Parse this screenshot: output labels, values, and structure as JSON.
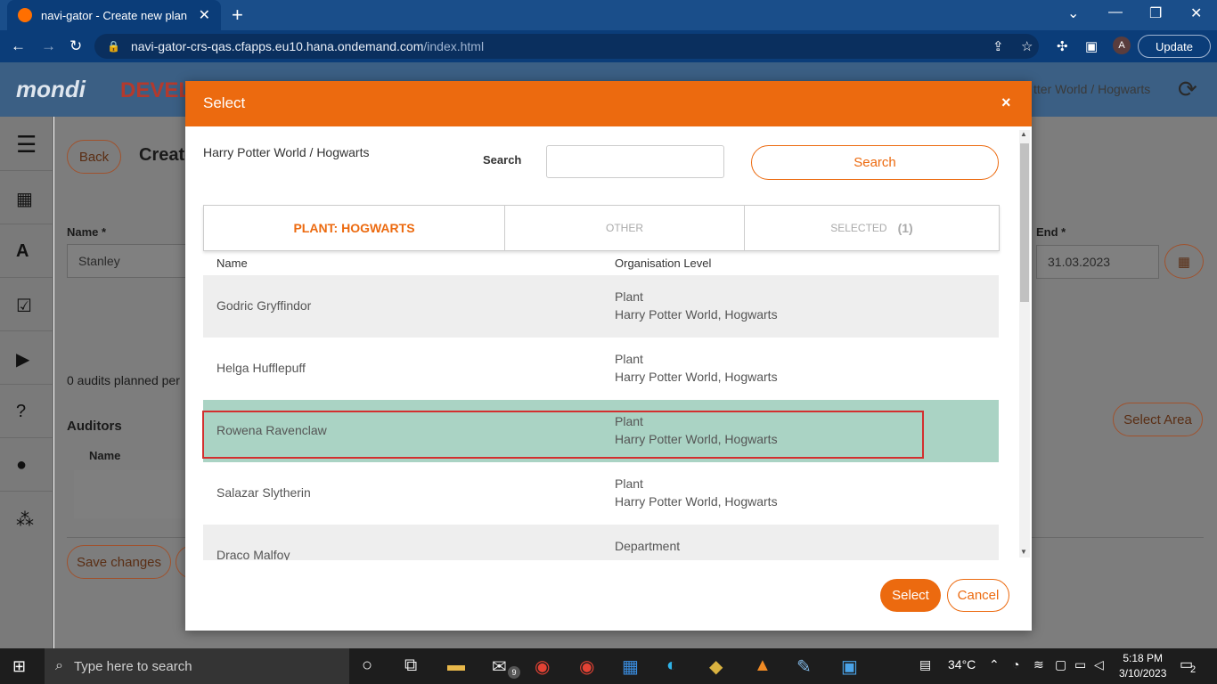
{
  "browser": {
    "tab_title": "navi-gator - Create new plan",
    "url_host": "navi-gator-crs-qas.cfapps.eu10.hana.ondemand.com",
    "url_path": "/index.html",
    "profile_initial": "A",
    "update_label": "Update"
  },
  "app": {
    "logo_text": "mondi",
    "env_label": "DEVEL",
    "breadcrumb": "tter World / Hogwarts",
    "back_label": "Back",
    "page_title": "Create",
    "name_label": "Name *",
    "name_value": "Stanley",
    "end_label": "End *",
    "end_value": "31.03.2023",
    "audits_text": "0 audits planned per",
    "auditors_heading": "Auditors",
    "auditors_col_name": "Name",
    "save_label": "Save changes",
    "select_area_label": "Select Area"
  },
  "dialog": {
    "title": "Select",
    "close_glyph": "×",
    "path": "Harry Potter World / Hogwarts",
    "search_label": "Search",
    "search_placeholder": "",
    "search_button": "Search",
    "tabs": [
      {
        "label": "PLANT: HOGWARTS",
        "active": true
      },
      {
        "label": "OTHER",
        "active": false
      },
      {
        "label": "SELECTED",
        "count": "(1)",
        "active": false
      }
    ],
    "columns": [
      "Name",
      "Organisation Level"
    ],
    "rows": [
      {
        "name": "Godric Gryffindor",
        "level": "Plant",
        "path": "Harry Potter World, Hogwarts"
      },
      {
        "name": "Helga Hufflepuff",
        "level": "Plant",
        "path": "Harry Potter World, Hogwarts"
      },
      {
        "name": "Rowena Ravenclaw",
        "level": "Plant",
        "path": "Harry Potter World, Hogwarts",
        "selected": true
      },
      {
        "name": "Salazar Slytherin",
        "level": "Plant",
        "path": "Harry Potter World, Hogwarts"
      },
      {
        "name": "Draco Malfoy",
        "level": "Department",
        "path": ""
      }
    ],
    "select_button": "Select",
    "cancel_button": "Cancel"
  },
  "taskbar": {
    "search_placeholder": "Type here to search",
    "temperature": "34°C",
    "time": "5:18 PM",
    "date": "3/10/2023",
    "mail_badge": "9",
    "notif_count": "2"
  },
  "colors": {
    "accent": "#ec6a0f",
    "selected_row": "#aad3c4",
    "highlight_border": "#d32f2f"
  }
}
